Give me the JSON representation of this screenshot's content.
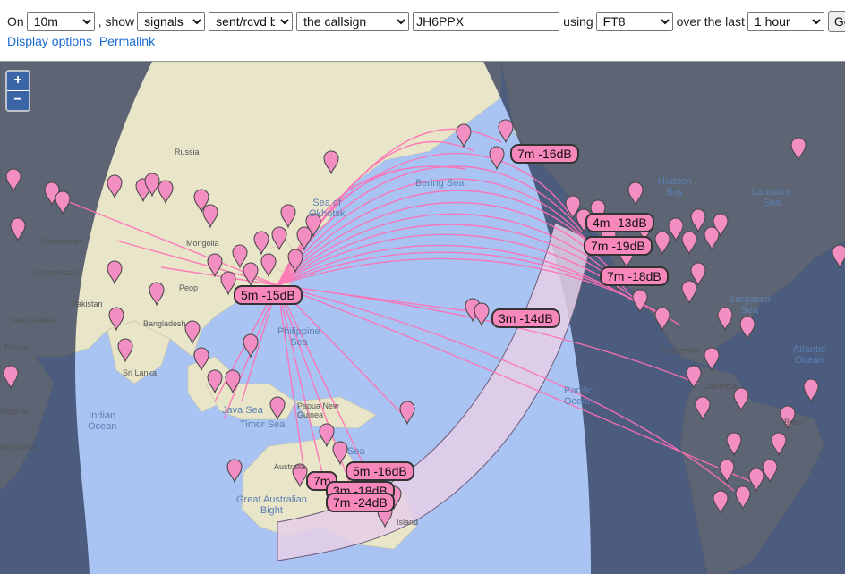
{
  "controls": {
    "on_label": "On",
    "band": "10m",
    "show_label": ", show",
    "show": "signals",
    "direction": "sent/rcvd by",
    "target": "the callsign",
    "callsign": "JH6PPX",
    "using_label": "using",
    "mode": "FT8",
    "over_label": "over the last",
    "period": "1 hour",
    "go": "Go!"
  },
  "links": {
    "display_options": "Display options",
    "permalink": "Permalink"
  },
  "zoom": {
    "in": "+",
    "out": "−"
  },
  "spot_labels": [
    "7m -16dB",
    "4m -13dB",
    "7m -19dB",
    "7m -18dB",
    "5m -15dB",
    "3m -14dB",
    "5m -16dB",
    "7m",
    "3m -18dB",
    "7m -24dB"
  ],
  "map_labels": {
    "russia": "Russia",
    "kazakhstan": "Kazakhstan",
    "mongolia": "Mongolia",
    "turkmenistan": "Turkmenistan",
    "pakistan": "Pakistan",
    "saudi": "Saudi Arabia",
    "bangladesh": "Bangladesh",
    "sri_lanka": "Sri Lanka",
    "eritrea": "Eritrea",
    "tanzania": "anzania",
    "madagascar": "adagascar",
    "indian_ocean": "Indian\nOcean",
    "sea_okhotsk": "Sea of\nOkhotsk",
    "bering": "Bering Sea",
    "hudson": "Hudson\nBay",
    "labrador": "Labrador\nSea",
    "sargasso": "Sargasso\nSea",
    "atlantic": "Atlantic\nOcean",
    "pacific": "Pacific\nOcean",
    "philippine": "Philippine\nSea",
    "java": "Java Sea",
    "timor": "Timor Sea",
    "png": "Papua New\nGuinea",
    "coral": "Sea",
    "australia": "Australia",
    "bight": "Great Australian\nBight",
    "colombia": "Colombia",
    "brazil": "Brazil",
    "guatemala": "Guatemala",
    "peoples": "Peop",
    "island": "Island"
  },
  "colors": {
    "ocean": "#a9c4f2",
    "land": "#e9e5c9",
    "night": "#2e3a57",
    "path": "#ff6fb5",
    "marker": "#f28ec1",
    "label_bg": "#f887bb"
  }
}
